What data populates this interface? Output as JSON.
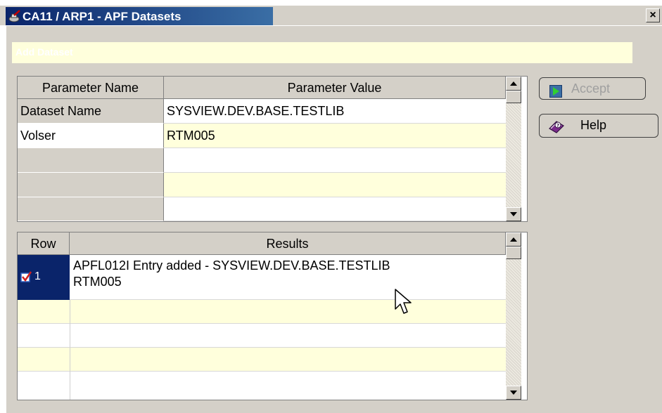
{
  "window": {
    "title": "CA11 / ARP1 - APF Datasets",
    "close_label": "×"
  },
  "info_bar": {
    "text": "Add Dataset"
  },
  "parameters": {
    "headers": [
      "Parameter Name",
      "Parameter Value"
    ],
    "rows": [
      {
        "name": "Dataset Name",
        "value": "SYSVIEW.DEV.BASE.TESTLIB"
      },
      {
        "name": "Volser",
        "value": "RTM005"
      },
      {
        "name": "",
        "value": ""
      },
      {
        "name": "",
        "value": ""
      },
      {
        "name": "",
        "value": ""
      }
    ]
  },
  "results": {
    "headers": [
      "Row",
      "Results"
    ],
    "rows": [
      {
        "row": "1",
        "text": "APFL012I Entry added - SYSVIEW.DEV.BASE.TESTLIB",
        "text2": "RTM005",
        "checked": true
      }
    ]
  },
  "buttons": {
    "accept_label": "Accept",
    "help_label": "Help"
  },
  "colors": {
    "titlebar": "#0a246a",
    "row_cream": "#ffffdc",
    "face": "#d4d0c8"
  },
  "icons": {
    "title": "check-wand-icon",
    "accept": "play-arrow-icon",
    "help": "help-book-icon",
    "row_status": "checkmark-icon"
  }
}
